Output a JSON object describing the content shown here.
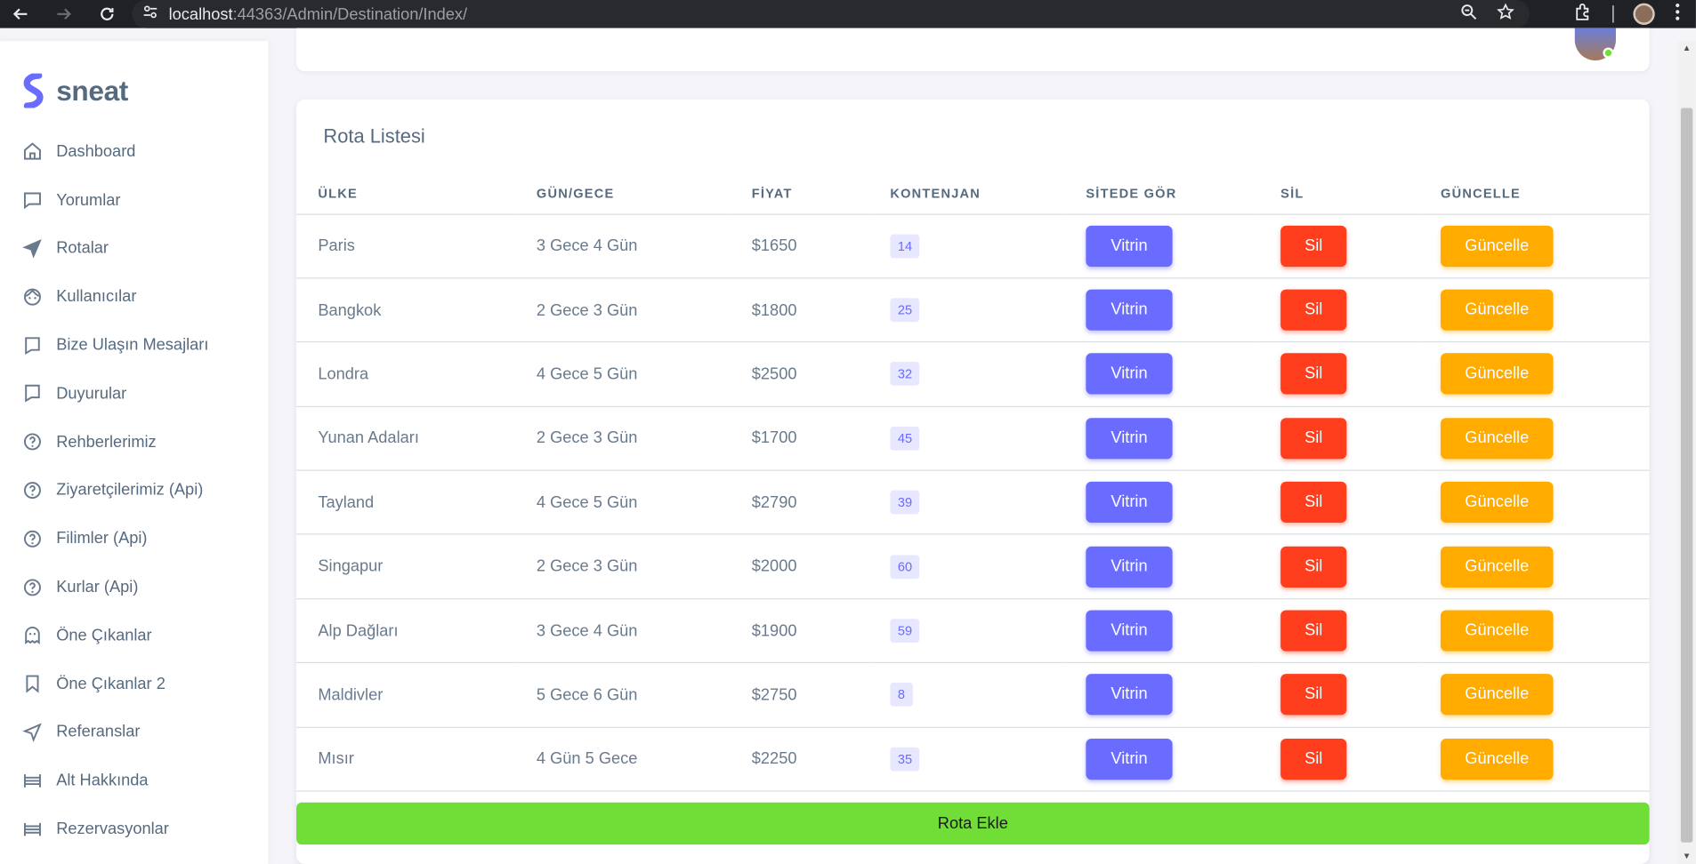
{
  "browser": {
    "url_host": "localhost",
    "url_path": ":44363/Admin/Destination/Index/"
  },
  "brand": {
    "name": "sneat",
    "color": "#696cff"
  },
  "sidebar": {
    "items": [
      {
        "label": "Dashboard",
        "icon": "home-icon"
      },
      {
        "label": "Yorumlar",
        "icon": "comment-icon"
      },
      {
        "label": "Rotalar",
        "icon": "plane-icon"
      },
      {
        "label": "Kullanıcılar",
        "icon": "user-face-icon"
      },
      {
        "label": "Bize Ulaşın Mesajları",
        "icon": "message-icon"
      },
      {
        "label": "Duyurular",
        "icon": "message-icon"
      },
      {
        "label": "Rehberlerimiz",
        "icon": "help-circle-icon"
      },
      {
        "label": "Ziyaretçilerimiz (Api)",
        "icon": "help-circle-icon"
      },
      {
        "label": "Filimler (Api)",
        "icon": "help-circle-icon"
      },
      {
        "label": "Kurlar (Api)",
        "icon": "help-circle-icon"
      },
      {
        "label": "Öne Çıkanlar",
        "icon": "ghost-icon"
      },
      {
        "label": "Öne Çıkanlar 2",
        "icon": "bookmark-icon"
      },
      {
        "label": "Referanslar",
        "icon": "send-icon"
      },
      {
        "label": "Alt Hakkında",
        "icon": "list-icon"
      },
      {
        "label": "Rezervasyonlar",
        "icon": "list-icon"
      }
    ]
  },
  "card": {
    "title": "Rota Listesi",
    "add_button": "Rota Ekle"
  },
  "table": {
    "headers": [
      "ÜLKE",
      "GÜN/GECE",
      "FİYAT",
      "KONTENJAN",
      "SİTEDE GÖR",
      "SİL",
      "GÜNCELLE"
    ],
    "button_labels": {
      "vitrin": "Vitrin",
      "sil": "Sil",
      "guncelle": "Güncelle"
    },
    "rows": [
      {
        "country": "Paris",
        "duration": "3 Gece 4 Gün",
        "price": "$1650",
        "capacity": "14"
      },
      {
        "country": "Bangkok",
        "duration": "2 Gece 3 Gün",
        "price": "$1800",
        "capacity": "25"
      },
      {
        "country": "Londra",
        "duration": "4 Gece 5 Gün",
        "price": "$2500",
        "capacity": "32"
      },
      {
        "country": "Yunan Adaları",
        "duration": "2 Gece 3 Gün",
        "price": "$1700",
        "capacity": "45"
      },
      {
        "country": "Tayland",
        "duration": "4 Gece 5 Gün",
        "price": "$2790",
        "capacity": "39"
      },
      {
        "country": "Singapur",
        "duration": "2 Gece 3 Gün",
        "price": "$2000",
        "capacity": "60"
      },
      {
        "country": "Alp Dağları",
        "duration": "3 Gece 4 Gün",
        "price": "$1900",
        "capacity": "59"
      },
      {
        "country": "Maldivler",
        "duration": "5 Gece 6 Gün",
        "price": "$2750",
        "capacity": "8"
      },
      {
        "country": "Mısır",
        "duration": "4 Gün 5 Gece",
        "price": "$2250",
        "capacity": "35"
      }
    ]
  },
  "colors": {
    "primary": "#696cff",
    "danger": "#ff3e1d",
    "warning": "#ffab00",
    "success": "#71dd37"
  }
}
